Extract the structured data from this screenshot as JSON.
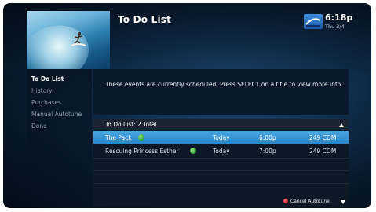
{
  "header": {
    "title": "To Do List",
    "time": "6:18p",
    "date": "Thu 3/4"
  },
  "sidebar": {
    "items": [
      {
        "label": "To Do List",
        "active": true
      },
      {
        "label": "History",
        "active": false
      },
      {
        "label": "Purchases",
        "active": false
      },
      {
        "label": "Manual Autotune",
        "active": false
      },
      {
        "label": "Done",
        "active": false
      }
    ]
  },
  "info": {
    "text": "These events are currently scheduled. Press SELECT on a title to view more info."
  },
  "list": {
    "header": "To Do List: 2 Total",
    "rows": [
      {
        "title": "The Pack",
        "day": "Today",
        "time": "6:00p",
        "channel": "249 COM",
        "selected": true
      },
      {
        "title": "Rescuing Princess Esther",
        "day": "Today",
        "time": "7:00p",
        "channel": "249 COM",
        "selected": false
      }
    ]
  },
  "footer": {
    "action_label": "Cancel Autotune"
  },
  "colors": {
    "selection": "#2f8ccc",
    "status_dot": "#2ea33a",
    "red_button": "#d01818"
  },
  "icons": {
    "status": "green-dot-icon",
    "red_button": "red-button-icon",
    "scroll_up": "scroll-up-icon",
    "scroll_down": "scroll-down-icon",
    "logo": "directv-logo"
  }
}
